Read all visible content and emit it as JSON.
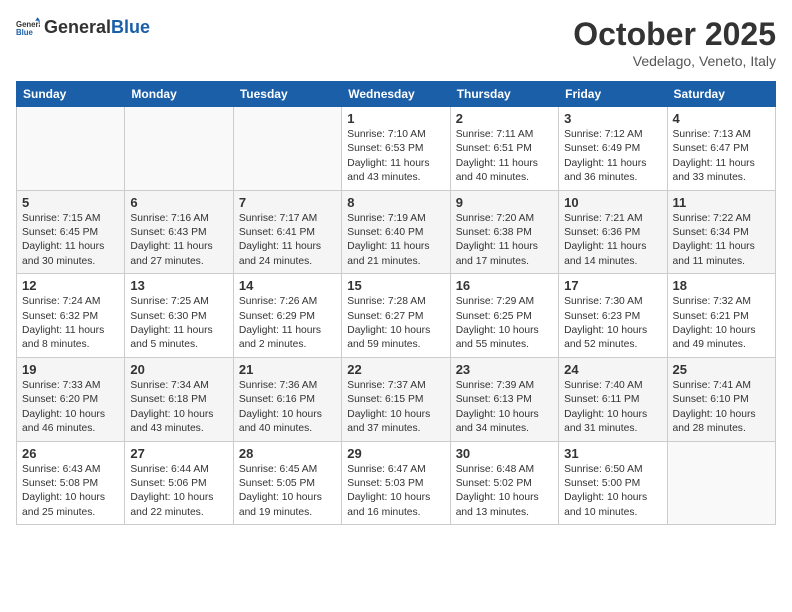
{
  "header": {
    "logo_general": "General",
    "logo_blue": "Blue",
    "month_title": "October 2025",
    "location": "Vedelago, Veneto, Italy"
  },
  "weekdays": [
    "Sunday",
    "Monday",
    "Tuesday",
    "Wednesday",
    "Thursday",
    "Friday",
    "Saturday"
  ],
  "weeks": [
    [
      {
        "day": "",
        "info": ""
      },
      {
        "day": "",
        "info": ""
      },
      {
        "day": "",
        "info": ""
      },
      {
        "day": "1",
        "info": "Sunrise: 7:10 AM\nSunset: 6:53 PM\nDaylight: 11 hours\nand 43 minutes."
      },
      {
        "day": "2",
        "info": "Sunrise: 7:11 AM\nSunset: 6:51 PM\nDaylight: 11 hours\nand 40 minutes."
      },
      {
        "day": "3",
        "info": "Sunrise: 7:12 AM\nSunset: 6:49 PM\nDaylight: 11 hours\nand 36 minutes."
      },
      {
        "day": "4",
        "info": "Sunrise: 7:13 AM\nSunset: 6:47 PM\nDaylight: 11 hours\nand 33 minutes."
      }
    ],
    [
      {
        "day": "5",
        "info": "Sunrise: 7:15 AM\nSunset: 6:45 PM\nDaylight: 11 hours\nand 30 minutes."
      },
      {
        "day": "6",
        "info": "Sunrise: 7:16 AM\nSunset: 6:43 PM\nDaylight: 11 hours\nand 27 minutes."
      },
      {
        "day": "7",
        "info": "Sunrise: 7:17 AM\nSunset: 6:41 PM\nDaylight: 11 hours\nand 24 minutes."
      },
      {
        "day": "8",
        "info": "Sunrise: 7:19 AM\nSunset: 6:40 PM\nDaylight: 11 hours\nand 21 minutes."
      },
      {
        "day": "9",
        "info": "Sunrise: 7:20 AM\nSunset: 6:38 PM\nDaylight: 11 hours\nand 17 minutes."
      },
      {
        "day": "10",
        "info": "Sunrise: 7:21 AM\nSunset: 6:36 PM\nDaylight: 11 hours\nand 14 minutes."
      },
      {
        "day": "11",
        "info": "Sunrise: 7:22 AM\nSunset: 6:34 PM\nDaylight: 11 hours\nand 11 minutes."
      }
    ],
    [
      {
        "day": "12",
        "info": "Sunrise: 7:24 AM\nSunset: 6:32 PM\nDaylight: 11 hours\nand 8 minutes."
      },
      {
        "day": "13",
        "info": "Sunrise: 7:25 AM\nSunset: 6:30 PM\nDaylight: 11 hours\nand 5 minutes."
      },
      {
        "day": "14",
        "info": "Sunrise: 7:26 AM\nSunset: 6:29 PM\nDaylight: 11 hours\nand 2 minutes."
      },
      {
        "day": "15",
        "info": "Sunrise: 7:28 AM\nSunset: 6:27 PM\nDaylight: 10 hours\nand 59 minutes."
      },
      {
        "day": "16",
        "info": "Sunrise: 7:29 AM\nSunset: 6:25 PM\nDaylight: 10 hours\nand 55 minutes."
      },
      {
        "day": "17",
        "info": "Sunrise: 7:30 AM\nSunset: 6:23 PM\nDaylight: 10 hours\nand 52 minutes."
      },
      {
        "day": "18",
        "info": "Sunrise: 7:32 AM\nSunset: 6:21 PM\nDaylight: 10 hours\nand 49 minutes."
      }
    ],
    [
      {
        "day": "19",
        "info": "Sunrise: 7:33 AM\nSunset: 6:20 PM\nDaylight: 10 hours\nand 46 minutes."
      },
      {
        "day": "20",
        "info": "Sunrise: 7:34 AM\nSunset: 6:18 PM\nDaylight: 10 hours\nand 43 minutes."
      },
      {
        "day": "21",
        "info": "Sunrise: 7:36 AM\nSunset: 6:16 PM\nDaylight: 10 hours\nand 40 minutes."
      },
      {
        "day": "22",
        "info": "Sunrise: 7:37 AM\nSunset: 6:15 PM\nDaylight: 10 hours\nand 37 minutes."
      },
      {
        "day": "23",
        "info": "Sunrise: 7:39 AM\nSunset: 6:13 PM\nDaylight: 10 hours\nand 34 minutes."
      },
      {
        "day": "24",
        "info": "Sunrise: 7:40 AM\nSunset: 6:11 PM\nDaylight: 10 hours\nand 31 minutes."
      },
      {
        "day": "25",
        "info": "Sunrise: 7:41 AM\nSunset: 6:10 PM\nDaylight: 10 hours\nand 28 minutes."
      }
    ],
    [
      {
        "day": "26",
        "info": "Sunrise: 6:43 AM\nSunset: 5:08 PM\nDaylight: 10 hours\nand 25 minutes."
      },
      {
        "day": "27",
        "info": "Sunrise: 6:44 AM\nSunset: 5:06 PM\nDaylight: 10 hours\nand 22 minutes."
      },
      {
        "day": "28",
        "info": "Sunrise: 6:45 AM\nSunset: 5:05 PM\nDaylight: 10 hours\nand 19 minutes."
      },
      {
        "day": "29",
        "info": "Sunrise: 6:47 AM\nSunset: 5:03 PM\nDaylight: 10 hours\nand 16 minutes."
      },
      {
        "day": "30",
        "info": "Sunrise: 6:48 AM\nSunset: 5:02 PM\nDaylight: 10 hours\nand 13 minutes."
      },
      {
        "day": "31",
        "info": "Sunrise: 6:50 AM\nSunset: 5:00 PM\nDaylight: 10 hours\nand 10 minutes."
      },
      {
        "day": "",
        "info": ""
      }
    ]
  ]
}
